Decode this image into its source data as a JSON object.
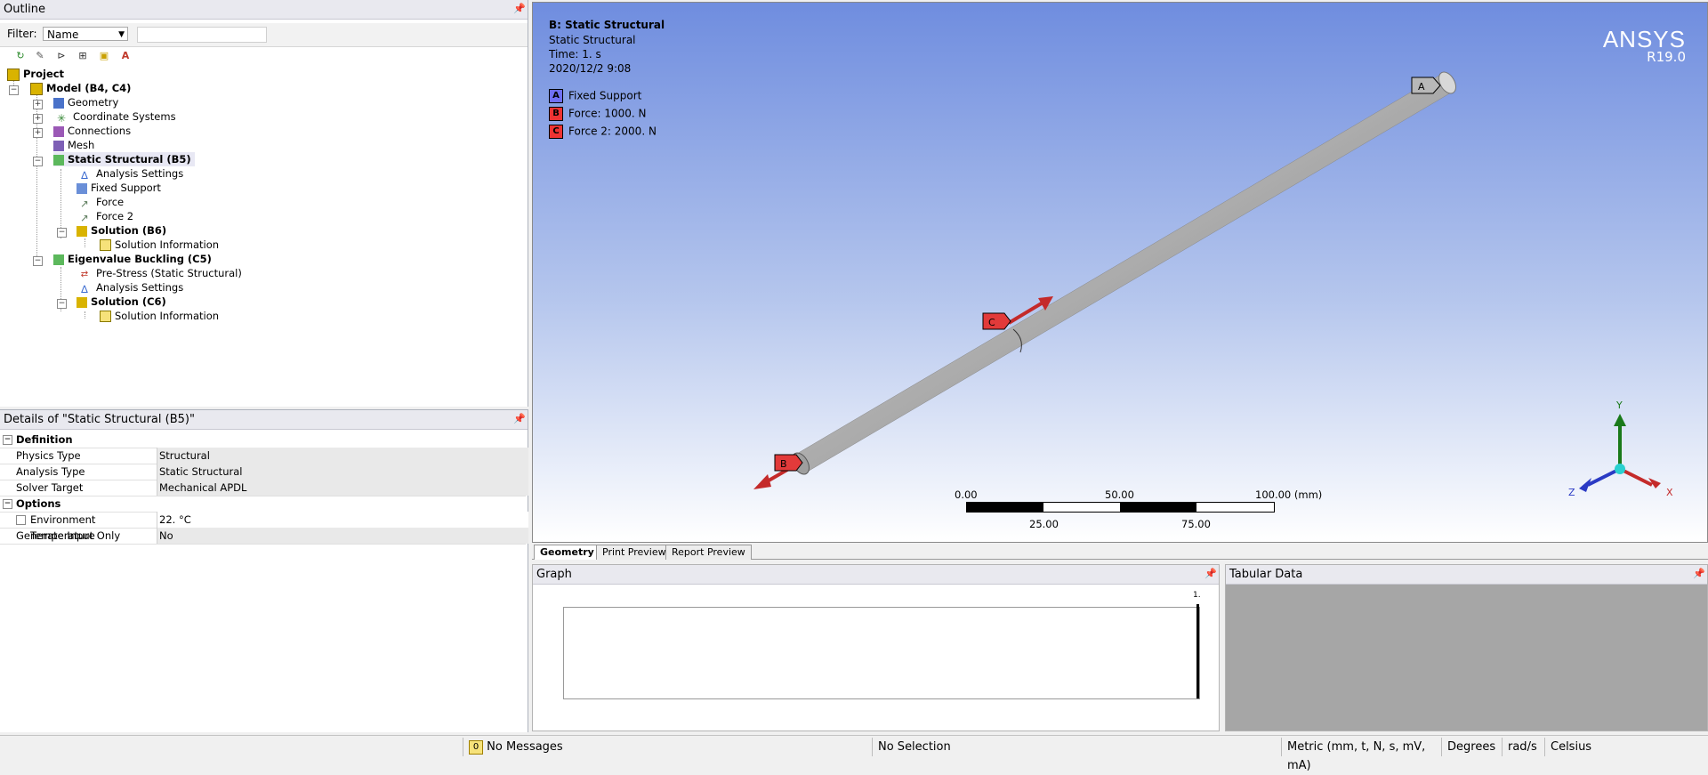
{
  "outline": {
    "title": "Outline",
    "filter_label": "Filter:",
    "filter_value": "Name",
    "tree": [
      {
        "label": "Project",
        "bold": true
      },
      {
        "label": "Model (B4, C4)",
        "bold": true
      },
      {
        "label": "Geometry",
        "bold": false
      },
      {
        "label": "Coordinate Systems",
        "bold": false
      },
      {
        "label": "Connections",
        "bold": false
      },
      {
        "label": "Mesh",
        "bold": false
      },
      {
        "label": "Static Structural (B5)",
        "bold": true
      },
      {
        "label": "Analysis Settings",
        "bold": false
      },
      {
        "label": "Fixed Support",
        "bold": false
      },
      {
        "label": "Force",
        "bold": false
      },
      {
        "label": "Force 2",
        "bold": false
      },
      {
        "label": "Solution (B6)",
        "bold": true
      },
      {
        "label": "Solution Information",
        "bold": false
      },
      {
        "label": "Eigenvalue Buckling (C5)",
        "bold": true
      },
      {
        "label": "Pre-Stress (Static Structural)",
        "bold": false
      },
      {
        "label": "Analysis Settings",
        "bold": false
      },
      {
        "label": "Solution (C6)",
        "bold": true
      },
      {
        "label": "Solution Information",
        "bold": false
      }
    ]
  },
  "details": {
    "title": "Details of \"Static Structural (B5)\"",
    "sections": [
      {
        "name": "Definition",
        "rows": [
          {
            "label": "Physics Type",
            "value": "Structural"
          },
          {
            "label": "Analysis Type",
            "value": "Static Structural"
          },
          {
            "label": "Solver Target",
            "value": "Mechanical APDL"
          }
        ]
      },
      {
        "name": "Options",
        "rows": [
          {
            "label": "Environment Temperature",
            "value": "22. °C"
          },
          {
            "label": "Generate Input Only",
            "value": "No"
          }
        ]
      }
    ]
  },
  "viewport": {
    "title": "B: Static Structural",
    "subtitle": "Static Structural",
    "time": "Time: 1. s",
    "date": "2020/12/2 9:08",
    "legend": [
      {
        "key": "A",
        "label": "Fixed Support",
        "color": "#6f6ff5"
      },
      {
        "key": "B",
        "label": "Force: 1000. N",
        "color": "#ee3333"
      },
      {
        "key": "C",
        "label": "Force 2: 2000. N",
        "color": "#ee3333"
      }
    ],
    "brand": "ANSYS",
    "version": "R19.0",
    "scale_top": [
      "0.00",
      "50.00",
      "100.00 (mm)"
    ],
    "scale_bottom": [
      "25.00",
      "75.00"
    ],
    "markers": {
      "a": "A",
      "b": "B",
      "c": "C"
    },
    "axes": {
      "x": "X",
      "y": "Y",
      "z": "Z"
    }
  },
  "tabs": [
    "Geometry",
    "Print Preview",
    "Report Preview"
  ],
  "graph": {
    "title": "Graph",
    "tick": "1."
  },
  "tabular": {
    "title": "Tabular Data"
  },
  "status": {
    "messages_count": "0",
    "messages": "No Messages",
    "selection": "No Selection",
    "units": "Metric (mm, t, N, s, mV, mA)",
    "angle": "Degrees",
    "rot": "rad/s",
    "temp": "Celsius"
  }
}
